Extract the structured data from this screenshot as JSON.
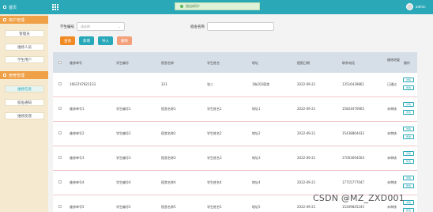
{
  "topbar": {
    "toast": "退出成功！",
    "username": "admin"
  },
  "sidebar": {
    "home": "首页",
    "groups": [
      {
        "title": "用户管理",
        "items": [
          "管理员",
          "维修人员",
          "学生用户"
        ]
      },
      {
        "title": "宿舍管理",
        "items": [
          "维修信息",
          "宿舍通知",
          "维修反馈"
        ]
      }
    ]
  },
  "search": {
    "student_no_label": "学生编号",
    "student_no_placeholder": "请选择",
    "dorm_name_label": "宿舍名称",
    "dorm_name_placeholder": ""
  },
  "buttons": {
    "search": "查询",
    "add": "新增",
    "import": "导入",
    "delete": "删除"
  },
  "table": {
    "columns": [
      "维修单号",
      "学生编号",
      "宿舍名称",
      "学生姓名",
      "地址",
      "提报日期",
      "联系电话",
      "维修进度",
      "操作"
    ],
    "rows": [
      [
        "1663747821133",
        "",
        "331",
        "张三",
        "1栋202宿舍",
        "2022-09-21",
        "13516439861",
        "已通过"
      ],
      [
        "维修单号1",
        "学生编号1",
        "宿舍名称1",
        "学生姓名1",
        "地址1",
        "2022-09-21",
        "15824070965",
        "未审核"
      ],
      [
        "维修单号2",
        "学生编号2",
        "宿舍名称2",
        "学生姓名2",
        "地址2",
        "2022-09-21",
        "15438864432",
        "未审核"
      ],
      [
        "维修单号3",
        "学生编号3",
        "宿舍名称3",
        "学生姓名3",
        "地址3",
        "2022-09-21",
        "17003694564",
        "未审核"
      ],
      [
        "维修单号4",
        "学生编号4",
        "宿舍名称4",
        "学生姓名4",
        "地址4",
        "2022-09-21",
        "17715777047",
        "未审核"
      ],
      [
        "维修单号5",
        "学生编号5",
        "宿舍名称5",
        "学生姓名5",
        "地址5",
        "2022-09-21",
        "15209845245",
        "未审核"
      ]
    ],
    "op_labels": [
      "详情",
      "修改"
    ]
  },
  "watermark": "CSDN @MZ_ZXD001",
  "colors": {
    "primary": "#2aa8b8",
    "sidebar_bg": "#f5e9cf",
    "sidebar_group": "#f0a046",
    "btn_search": "#f08a24",
    "btn_add": "#28a8b8",
    "btn_import": "#28a8b8",
    "btn_delete": "#f4a07a"
  }
}
